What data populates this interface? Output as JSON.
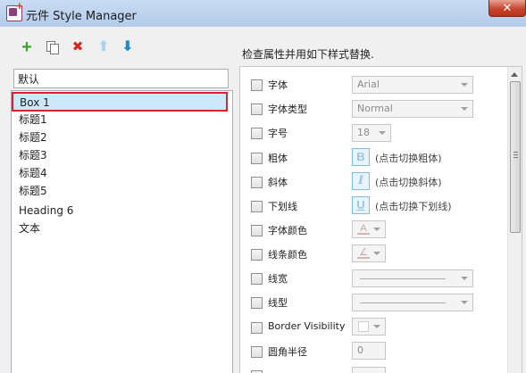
{
  "window": {
    "title": "元件 Style Manager",
    "close_label": "✕"
  },
  "toolbar": {
    "add_icon": "plus-icon",
    "duplicate_icon": "copy-icon",
    "delete_icon": "delete-icon",
    "move_up_icon": "arrow-up-icon",
    "move_down_icon": "arrow-down-icon"
  },
  "style_name": "默认",
  "styles": [
    "Box 1",
    "标题1",
    "标题2",
    "标题3",
    "标题4",
    "标题5",
    "Heading 6",
    "文本"
  ],
  "selected_index": 0,
  "hint": "检查属性并用如下样式替换.",
  "properties": {
    "font": {
      "label": "字体",
      "value": "Arial"
    },
    "font_type": {
      "label": "字体类型",
      "value": "Normal"
    },
    "font_size": {
      "label": "字号",
      "value": "18"
    },
    "bold": {
      "label": "粗体",
      "button": "B",
      "hint": "(点击切换粗体)"
    },
    "italic": {
      "label": "斜体",
      "button": "I",
      "hint": "(点击切换斜体)"
    },
    "underline": {
      "label": "下划线",
      "button": "U",
      "hint": "(点击切换下划线)"
    },
    "font_color": {
      "label": "字体颜色",
      "glyph": "A"
    },
    "line_color": {
      "label": "线条颜色",
      "glyph": "∠"
    },
    "line_width": {
      "label": "线宽"
    },
    "line_type": {
      "label": "线型"
    },
    "border_visibility": {
      "label": "Border Visibility"
    },
    "corner_radius": {
      "label": "圆角半径",
      "value": "0"
    }
  },
  "colors": {
    "selection_bg": "#cce8fa",
    "selection_border": "#e0202a",
    "toggle_border": "#7dbde6"
  }
}
